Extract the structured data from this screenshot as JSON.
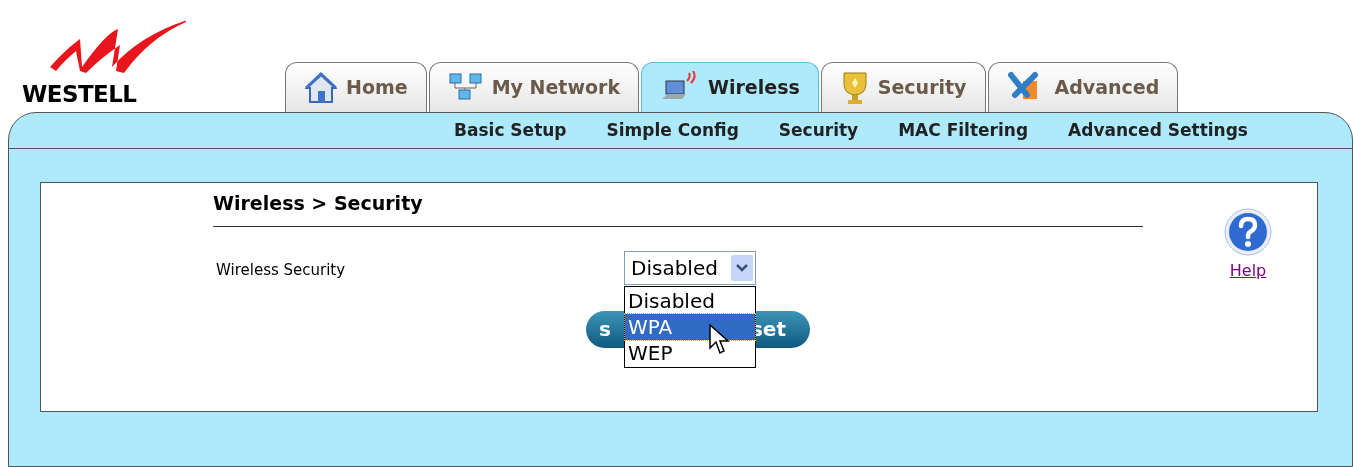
{
  "logo": {
    "text": "WESTELL"
  },
  "tabs": [
    {
      "label": "Home",
      "selected": false
    },
    {
      "label": "My Network",
      "selected": false
    },
    {
      "label": "Wireless",
      "selected": true
    },
    {
      "label": "Security",
      "selected": false
    },
    {
      "label": "Advanced",
      "selected": false
    }
  ],
  "subnav": [
    "Basic Setup",
    "Simple Config",
    "Security",
    "MAC Filtering",
    "Advanced Settings"
  ],
  "breadcrumb": "Wireless > Security",
  "form": {
    "label": "Wireless Security",
    "value": "Disabled",
    "options": [
      {
        "label": "Disabled",
        "highlighted": false
      },
      {
        "label": "WPA",
        "highlighted": true
      },
      {
        "label": "WEP",
        "highlighted": false
      }
    ]
  },
  "buttons": [
    "s",
    "set"
  ],
  "help": {
    "label": "Help"
  }
}
